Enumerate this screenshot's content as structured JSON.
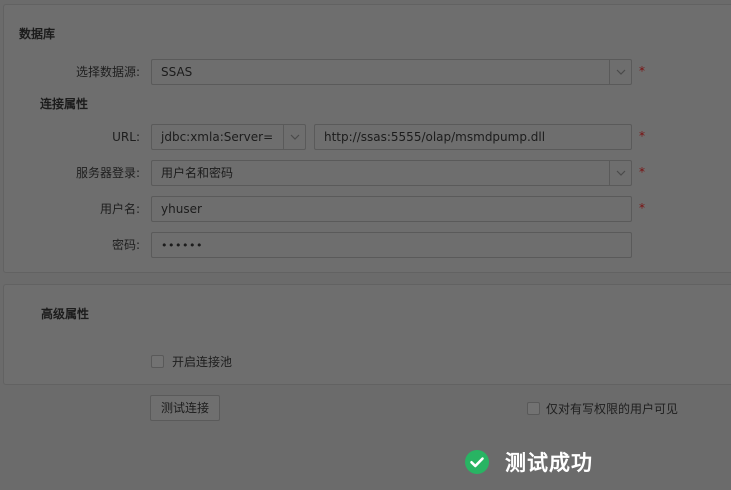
{
  "database_panel": {
    "title": "数据库",
    "datasource": {
      "label": "选择数据源:",
      "value": "SSAS",
      "required_mark": "*"
    },
    "connection_section_title": "连接属性",
    "url": {
      "label": "URL:",
      "driver_value": "jdbc:xmla:Server=",
      "value": "http://ssas:5555/olap/msmdpump.dll",
      "required_mark": "*"
    },
    "server_login": {
      "label": "服务器登录:",
      "value": "用户名和密码",
      "required_mark": "*"
    },
    "username": {
      "label": "用户名:",
      "value": "yhuser",
      "required_mark": "*"
    },
    "password": {
      "label": "密码:",
      "value": "••••••"
    }
  },
  "advanced_panel": {
    "title": "高级属性",
    "pool_checkbox": {
      "label": "开启连接池",
      "checked": false
    }
  },
  "footer": {
    "test_button_label": "测试连接",
    "write_only_checkbox": {
      "label": "仅对有写权限的用户可见",
      "checked": false
    }
  },
  "toast": {
    "message": "测试成功",
    "icon": "check-circle-icon",
    "icon_color": "#28b463"
  },
  "colors": {
    "overlay_background": "#6b6b6b",
    "required_mark": "#7a1010",
    "toast_text": "#ffffff"
  }
}
